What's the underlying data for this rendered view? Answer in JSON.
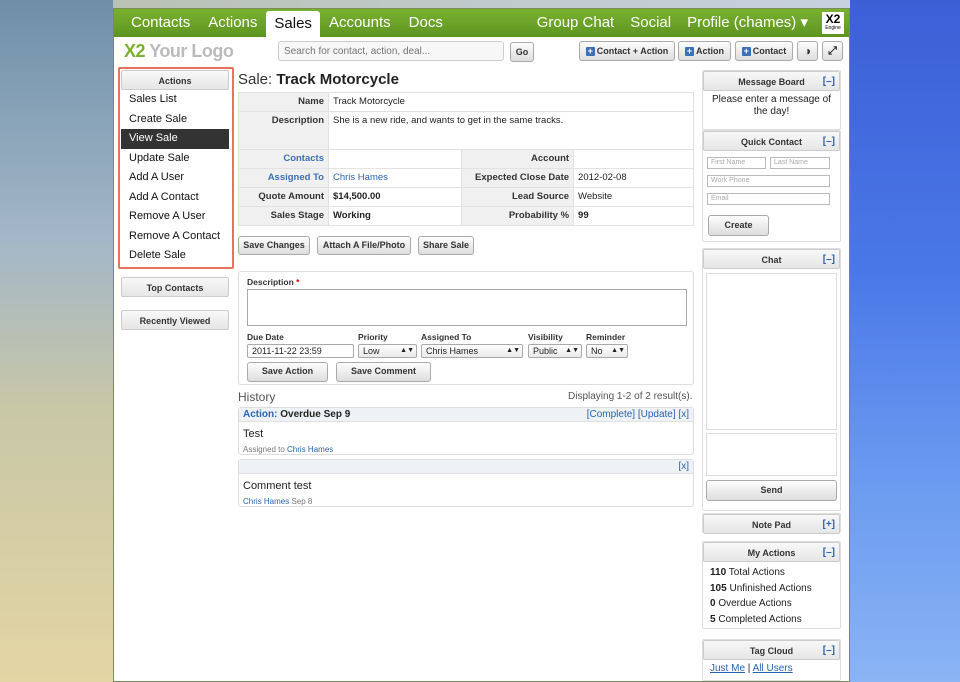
{
  "nav": {
    "tabs": [
      "Contacts",
      "Actions",
      "Sales",
      "Accounts",
      "Docs"
    ],
    "active": "Sales",
    "right": [
      "Group Chat",
      "Social",
      "Profile (chames) ▾"
    ],
    "brand": "X2",
    "brand_sub": "Engine"
  },
  "header": {
    "logo_x": "X2",
    "logo_text": " Your Logo",
    "search_placeholder": "Search for contact, action, deal...",
    "go": "Go",
    "btn_contact_action": "Contact + Action",
    "btn_action": "Action",
    "btn_contact": "Contact"
  },
  "sidebar": {
    "actions_title": "Actions",
    "items": [
      "Sales List",
      "Create Sale",
      "View Sale",
      "Update Sale",
      "Add A User",
      "Add A Contact",
      "Remove A User",
      "Remove A Contact",
      "Delete Sale"
    ],
    "active_index": 2,
    "top_contacts": "Top Contacts",
    "recently_viewed": "Recently Viewed"
  },
  "sale": {
    "title_prefix": "Sale:",
    "title": "Track Motorcycle",
    "name_lbl": "Name",
    "name": "Track Motorcycle",
    "desc_lbl": "Description",
    "desc": "She is a new ride, and wants to get in the same tracks.",
    "contacts_lbl": "Contacts",
    "account_lbl": "Account",
    "assigned_lbl": "Assigned To",
    "assigned": "Chris Hames",
    "close_lbl": "Expected Close Date",
    "close": "2012-02-08",
    "amount_lbl": "Quote Amount",
    "amount": "$14,500.00",
    "source_lbl": "Lead Source",
    "source": "Website",
    "stage_lbl": "Sales Stage",
    "stage": "Working",
    "prob_lbl": "Probability %",
    "prob": "99"
  },
  "buttons": {
    "save_changes": "Save Changes",
    "attach": "Attach A File/Photo",
    "share": "Share Sale"
  },
  "form": {
    "desc_lbl": "Description",
    "req": "*",
    "due_lbl": "Due Date",
    "due": "2011-11-22 23:59",
    "priority_lbl": "Priority",
    "priority": "Low",
    "assigned_lbl": "Assigned To",
    "assigned": "Chris Hames",
    "visibility_lbl": "Visibility",
    "visibility": "Public",
    "reminder_lbl": "Reminder",
    "reminder": "No",
    "save_action": "Save Action",
    "save_comment": "Save Comment"
  },
  "history": {
    "title": "History",
    "count": "Displaying 1-2 of 2 result(s).",
    "item1": {
      "head": "Action:",
      "head2": "Overdue Sep 9",
      "complete": "[Complete]",
      "update": "[Update]",
      "x": "[x]",
      "body": "Test",
      "meta": "Assigned to ",
      "user": "Chris Hames"
    },
    "item2": {
      "x": "[x]",
      "body": "Comment test",
      "user": "Chris Hames",
      "date": " Sep 8"
    }
  },
  "right": {
    "message_board": "Message Board",
    "message": "Please enter a message of the day!",
    "quick_contact": "Quick Contact",
    "first": "First Name",
    "last": "Last Name",
    "phone": "Work Phone",
    "email": "Email",
    "create": "Create",
    "chat": "Chat",
    "send": "Send",
    "notepad": "Note Pad",
    "plus": "[+]",
    "minus": "[–]",
    "my_actions": "My Actions",
    "stats": [
      {
        "n": "110",
        "t": " Total Actions"
      },
      {
        "n": "105",
        "t": " Unfinished Actions"
      },
      {
        "n": "0",
        "t": " Overdue Actions"
      },
      {
        "n": "5",
        "t": " Completed Actions"
      }
    ],
    "tag_cloud": "Tag Cloud",
    "just_me": "Just Me",
    "sep": " | ",
    "all_users": "All Users"
  }
}
